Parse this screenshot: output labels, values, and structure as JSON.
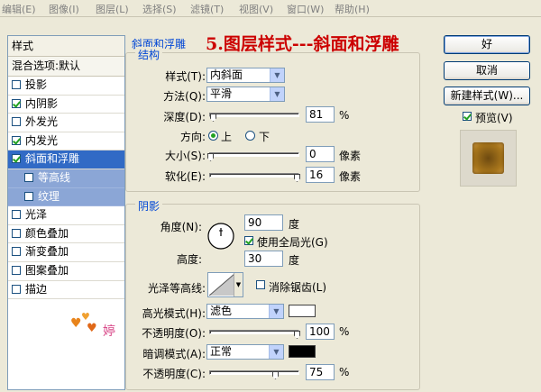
{
  "menubar": {
    "items": [
      "编辑(E)",
      "图像(I)",
      "图层(L)",
      "选择(S)",
      "滤镜(T)",
      "视图(V)",
      "窗口(W)",
      "帮助(H)"
    ]
  },
  "styles_panel": {
    "header": "样式",
    "blend_options": "混合选项:默认",
    "items": [
      {
        "label": "投影",
        "checked": false
      },
      {
        "label": "内阴影",
        "checked": true
      },
      {
        "label": "外发光",
        "checked": false
      },
      {
        "label": "内发光",
        "checked": true
      },
      {
        "label": "斜面和浮雕",
        "checked": true
      },
      {
        "label": "等高线",
        "checked": false
      },
      {
        "label": "纹理",
        "checked": false
      },
      {
        "label": "光泽",
        "checked": false
      },
      {
        "label": "颜色叠加",
        "checked": false
      },
      {
        "label": "渐变叠加",
        "checked": false
      },
      {
        "label": "图案叠加",
        "checked": false
      },
      {
        "label": "描边",
        "checked": false
      }
    ]
  },
  "overlay_title": "5.图层样式---斜面和浮雕",
  "bevel": {
    "section_title": "斜面和浮雕",
    "structure_title": "结构",
    "style_label": "样式(T):",
    "style_value": "内斜面",
    "technique_label": "方法(Q):",
    "technique_value": "平滑",
    "depth_label": "深度(D):",
    "depth_value": "81",
    "depth_unit": "%",
    "depth_level": 0.03,
    "direction_label": "方向:",
    "direction_up": "上",
    "direction_down": "下",
    "size_label": "大小(S):",
    "size_value": "0",
    "size_unit": "像素",
    "size_level": 0.0,
    "soften_label": "软化(E):",
    "soften_value": "16",
    "soften_unit": "像素",
    "soften_level": 1.0
  },
  "shading": {
    "title": "阴影",
    "angle_label": "角度(N):",
    "angle_value": "90",
    "angle_unit": "度",
    "global_light_label": "使用全局光(G)",
    "global_light_checked": true,
    "altitude_label": "高度:",
    "altitude_value": "30",
    "altitude_unit": "度",
    "gloss_label": "光泽等高线:",
    "antialias_label": "消除锯齿(L)",
    "antialias_checked": false,
    "highlight_mode_label": "高光模式(H):",
    "highlight_mode_value": "滤色",
    "highlight_color": "#ffffff",
    "highlight_opacity_label": "不透明度(O):",
    "highlight_opacity_value": "100",
    "highlight_opacity_unit": "%",
    "highlight_opacity_level": 1.0,
    "shadow_mode_label": "暗调模式(A):",
    "shadow_mode_value": "正常",
    "shadow_color": "#000000",
    "shadow_opacity_label": "不透明度(C):",
    "shadow_opacity_value": "75",
    "shadow_opacity_unit": "%",
    "shadow_opacity_level": 0.75
  },
  "buttons": {
    "ok": "好",
    "cancel": "取消",
    "new_style": "新建样式(W)...",
    "preview_label": "预览(V)",
    "preview_checked": true
  },
  "watermark_text": "婷",
  "colors": {
    "overlay_title": "#cc0000",
    "selection": "#316ac5",
    "sub_selection": "#8ba6d6",
    "preview_swatch": "#a8761c"
  }
}
